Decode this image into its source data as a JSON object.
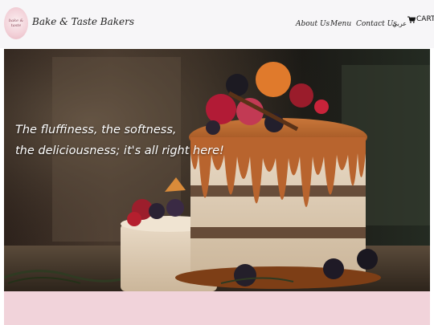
{
  "header": {
    "logo_text": "bake & taste",
    "brand": "Bake & Taste Bakers",
    "nav": [
      {
        "label": "About Us"
      },
      {
        "label": "Menu"
      },
      {
        "label": "Contact Us"
      },
      {
        "label": "عربي"
      }
    ],
    "cart_label": "CART"
  },
  "hero": {
    "line1": "The fluffiness, the softness,",
    "line2": "the deliciousness; it's all right here!"
  },
  "colors": {
    "header_bg": "#f7f6f8",
    "footer_band": "#f1d3da",
    "caramel": "#b8642e"
  }
}
